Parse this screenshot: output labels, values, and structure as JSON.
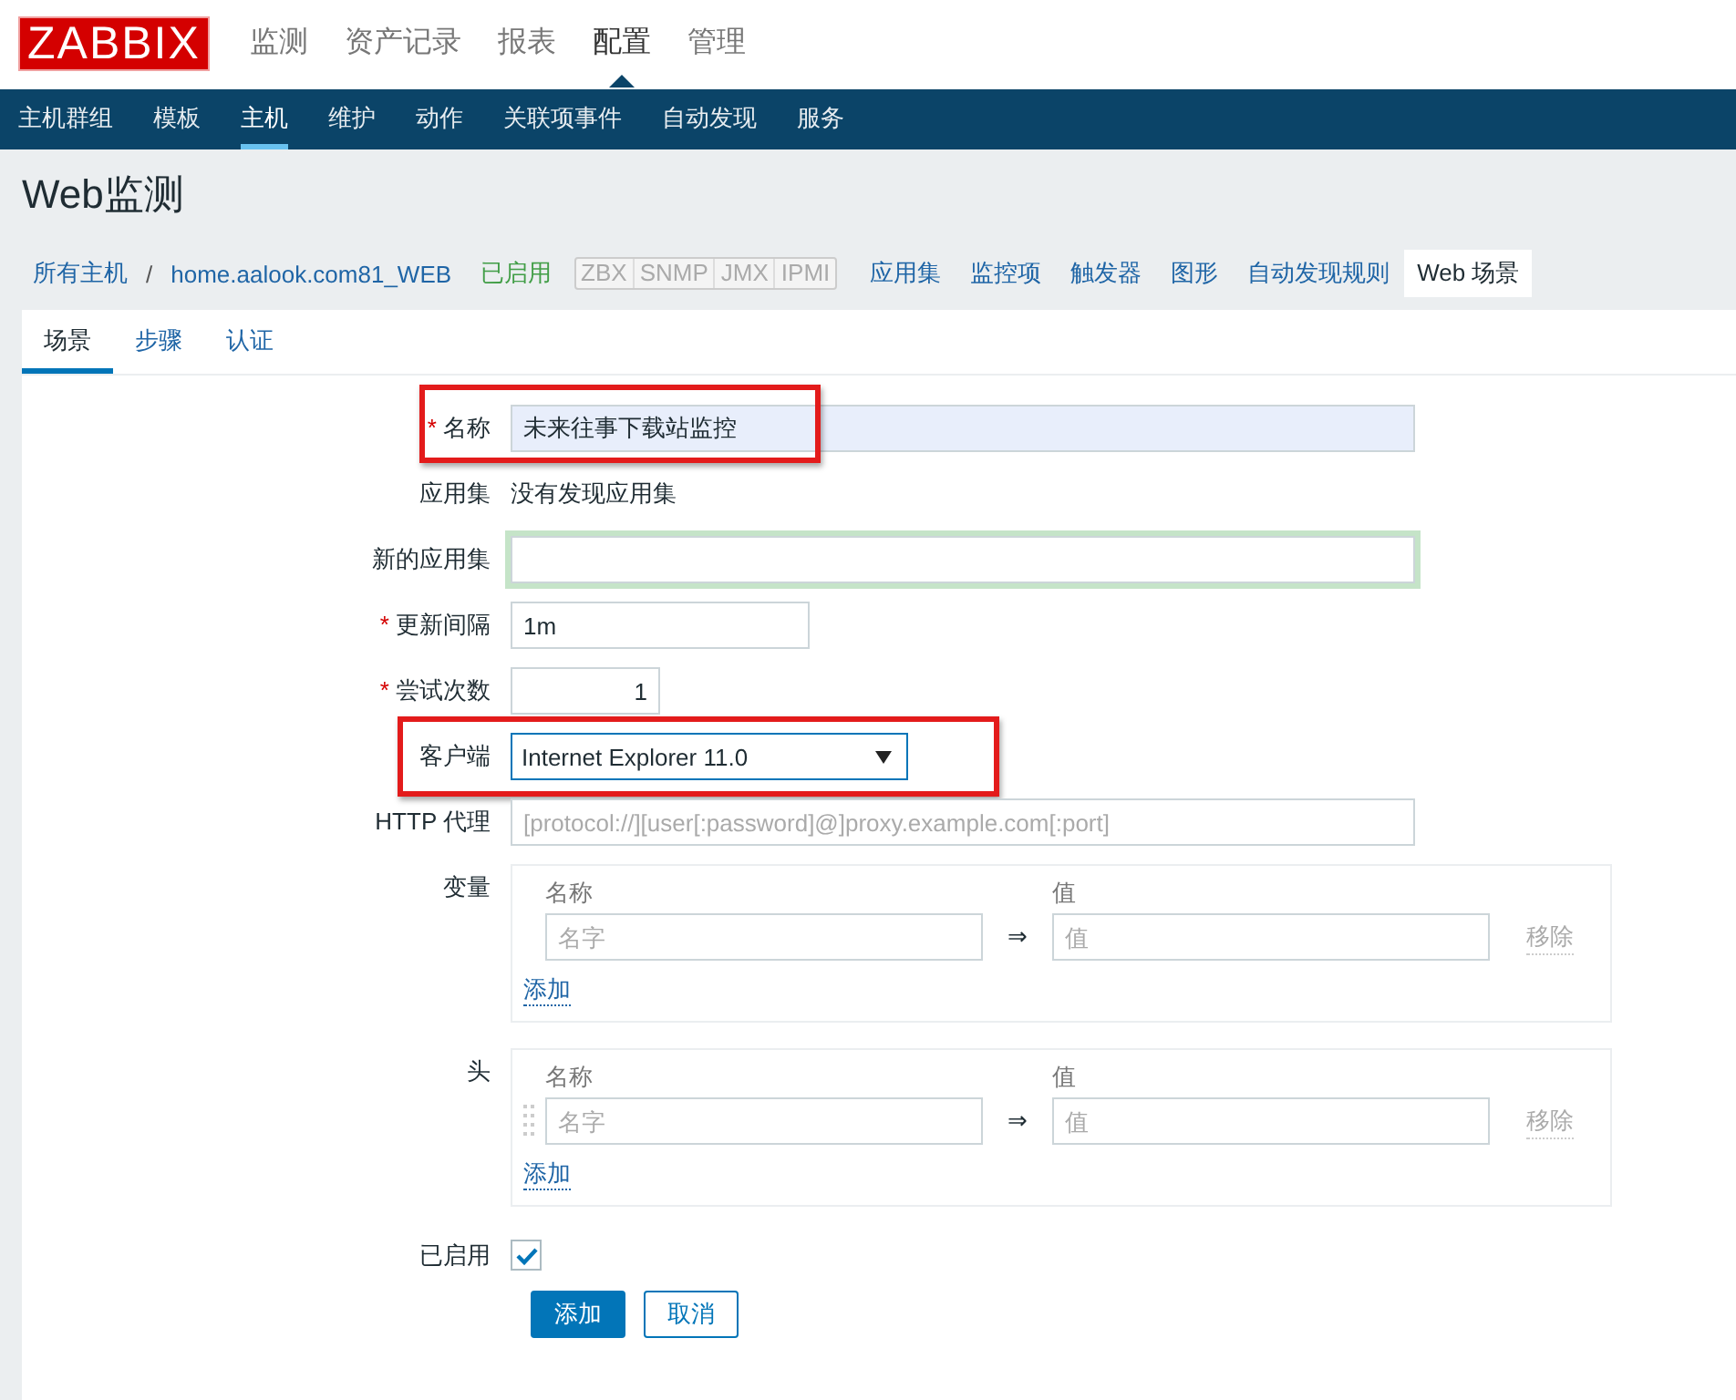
{
  "logo": "ZABBIX",
  "top_menu": [
    {
      "label": "监测",
      "selected": false
    },
    {
      "label": "资产记录",
      "selected": false
    },
    {
      "label": "报表",
      "selected": false
    },
    {
      "label": "配置",
      "selected": true
    },
    {
      "label": "管理",
      "selected": false
    }
  ],
  "sub_menu": [
    {
      "label": "主机群组",
      "selected": false
    },
    {
      "label": "模板",
      "selected": false
    },
    {
      "label": "主机",
      "selected": true
    },
    {
      "label": "维护",
      "selected": false
    },
    {
      "label": "动作",
      "selected": false
    },
    {
      "label": "关联项事件",
      "selected": false
    },
    {
      "label": "自动发现",
      "selected": false
    },
    {
      "label": "服务",
      "selected": false
    }
  ],
  "page_title": "Web监测",
  "breadcrumb": {
    "root": "所有主机",
    "separator": "/",
    "host": "home.aalook.com81_WEB",
    "status": "已启用",
    "availability": [
      {
        "label": "ZBX"
      },
      {
        "label": "SNMP"
      },
      {
        "label": "JMX"
      },
      {
        "label": "IPMI"
      }
    ],
    "links": [
      {
        "label": "应用集",
        "selected": false
      },
      {
        "label": "监控项",
        "selected": false
      },
      {
        "label": "触发器",
        "selected": false
      },
      {
        "label": "图形",
        "selected": false
      },
      {
        "label": "自动发现规则",
        "selected": false
      },
      {
        "label": "Web 场景",
        "selected": true
      }
    ]
  },
  "tabs": [
    {
      "label": "场景",
      "selected": true
    },
    {
      "label": "步骤",
      "selected": false
    },
    {
      "label": "认证",
      "selected": false
    }
  ],
  "form": {
    "required_mark": "*",
    "rows": [
      {
        "kind": "text",
        "label": "名称",
        "required": true,
        "value": "未来往事下载站监控",
        "highlighted": true,
        "filled": true
      },
      {
        "kind": "static",
        "label": "应用集",
        "value": "没有发现应用集"
      },
      {
        "kind": "text",
        "label": "新的应用集",
        "required": false,
        "focused": true
      },
      {
        "kind": "short_text",
        "label": "更新间隔",
        "required": true,
        "value": "1m"
      },
      {
        "kind": "number",
        "label": "尝试次数",
        "required": true,
        "value": "1"
      },
      {
        "kind": "select",
        "label": "客户端",
        "required": false,
        "value": "Internet Explorer 11.0",
        "highlighted": true
      },
      {
        "kind": "text",
        "label": "HTTP 代理",
        "required": false,
        "placeholder": "[protocol://][user[:password]@]proxy.example.com[:port]"
      },
      {
        "kind": "pairs",
        "label": "变量",
        "name_header": "名称",
        "value_header": "值",
        "add": "添加",
        "entries": [
          {
            "name_placeholder": "名字",
            "arrow": "⇒",
            "value_placeholder": "值",
            "remove": "移除",
            "draggable": false
          }
        ]
      },
      {
        "kind": "pairs",
        "label": "头",
        "name_header": "名称",
        "value_header": "值",
        "add": "添加",
        "entries": [
          {
            "name_placeholder": "名字",
            "arrow": "⇒",
            "value_placeholder": "值",
            "remove": "移除",
            "draggable": true
          }
        ]
      },
      {
        "kind": "checkbox",
        "label": "已启用",
        "checked": true
      }
    ],
    "buttons": [
      {
        "label": "添加",
        "kind": "primary"
      },
      {
        "label": "取消",
        "kind": "secondary"
      }
    ]
  }
}
